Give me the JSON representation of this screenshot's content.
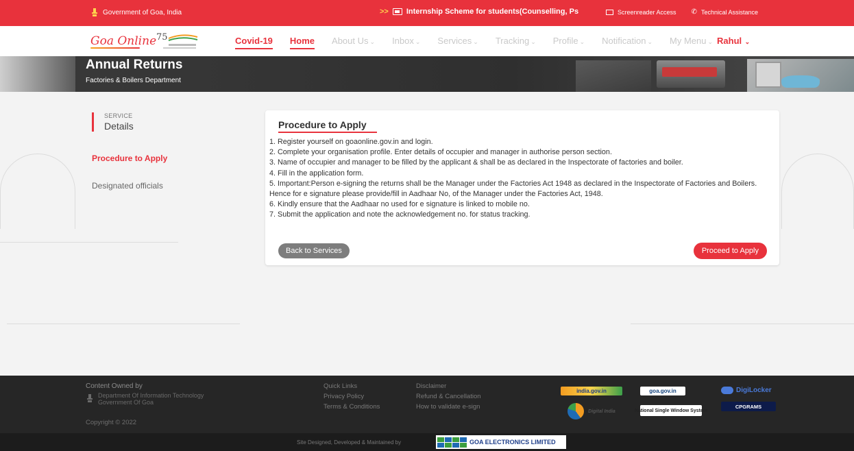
{
  "topbar": {
    "government": "Government of Goa, India",
    "ticker": "Internship Scheme for students(Counselling, Ps",
    "screenreader": "Screenreader Access",
    "assistance": "Technical Assistance"
  },
  "navbar": {
    "logo": "Goa Online",
    "items": [
      {
        "label": "Covid-19"
      },
      {
        "label": "Home"
      },
      {
        "label": "About Us"
      },
      {
        "label": "Inbox"
      },
      {
        "label": "Services"
      },
      {
        "label": "Tracking"
      },
      {
        "label": "Profile"
      },
      {
        "label": "Notification"
      },
      {
        "label": "My Menu"
      }
    ],
    "user": "Rahul"
  },
  "banner": {
    "title": "Annual Returns",
    "subtitle": "Factories & Boilers Department"
  },
  "sidebar": {
    "service_label": "SERVICE",
    "details_label": "Details",
    "links": [
      "Procedure to Apply",
      "Designated officials"
    ]
  },
  "procedure": {
    "heading": "Procedure to Apply",
    "steps": [
      "1. Register yourself on goaonline.gov.in and login.",
      "2. Complete your organisation profile. Enter details of occupier and manager in authorise person section.",
      "3. Name of occupier and manager to be filled by the applicant & shall be as declared in the Inspectorate of factories and boiler.",
      "4. Fill in the application form.",
      "5. Important:Person e-signing the returns shall be the Manager under the Factories Act 1948 as declared in the Inspectorate of Factories and Boilers. Hence for e signature please provide/fill in Aadhaar No, of the Manager under the Factories Act, 1948.",
      "6. Kindly ensure that the Aadhaar no used for e signature is linked to mobile no.",
      "7. Submit the application and note the acknowledgement no. for status tracking."
    ],
    "back_button": "Back to Services",
    "apply_button": "Proceed to Apply"
  },
  "footer": {
    "owned_by": "Content Owned by",
    "dept_line1": "Department Of Information Technology",
    "dept_line2": "Government Of Goa",
    "copyright": "Copyright © 2022",
    "links": [
      "Quick Links",
      "Disclaimer",
      "Privacy Policy",
      "Refund & Cancellation",
      "Terms & Conditions",
      "How to validate e-sign"
    ],
    "badges": {
      "india": "india.gov.in",
      "goa": "goa.gov.in",
      "digilocker": "DigiLocker",
      "digital_india": "Digital India",
      "nsws": "National Single Window System",
      "cpgrams": "CPGRAMS"
    },
    "designed_by": "Site Designed, Developed & Maintained by",
    "company": "GOA ELECTRONICS LIMITED"
  },
  "colors": {
    "accent": "#e8323c",
    "footer_bg": "#262626",
    "banner_bg": "#2f2f2f"
  }
}
